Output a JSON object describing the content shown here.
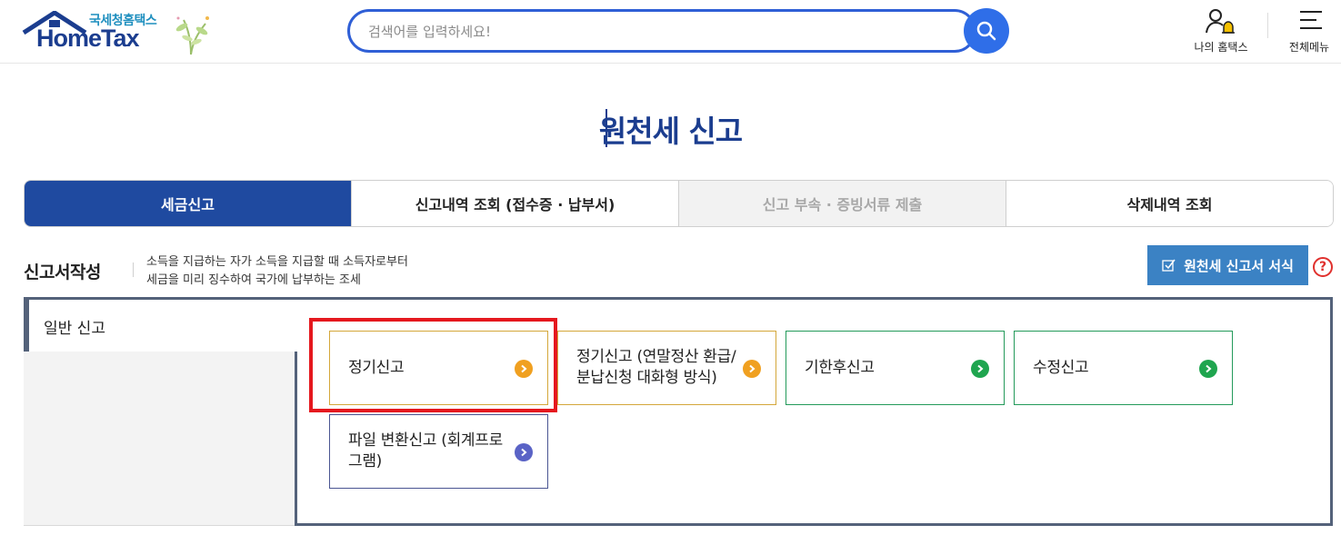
{
  "header": {
    "logo_small": "국세청홈택스",
    "logo_main": "HomeTax",
    "search_placeholder": "검색어를 입력하세요!",
    "my_hometax_label": "나의 홈택스",
    "all_menu_label": "전체메뉴"
  },
  "page": {
    "title": "원천세 신고"
  },
  "tabs": [
    {
      "label": "세금신고",
      "state": "active"
    },
    {
      "label": "신고내역 조회 (접수증 · 납부서)",
      "state": "normal"
    },
    {
      "label": "신고 부속 · 증빙서류 제출",
      "state": "disabled"
    },
    {
      "label": "삭제내역 조회",
      "state": "normal"
    }
  ],
  "section": {
    "title": "신고서작성",
    "desc_line1": "소득을 지급하는 자가 소득을 지급할 때 소득자로부터",
    "desc_line2": "세금을 미리 징수하여 국가에 납부하는 조세",
    "form_button_label": "원천세 신고서 서식",
    "help_symbol": "?"
  },
  "panel": {
    "left_tab_label": "일반 신고",
    "cards": [
      {
        "label": "정기신고",
        "color": "orange"
      },
      {
        "label": "정기신고 (연말정산 환급/분납신청 대화형 방식)",
        "color": "orange"
      },
      {
        "label": "기한후신고",
        "color": "green"
      },
      {
        "label": "수정신고",
        "color": "green"
      },
      {
        "label": "파일 변환신고 (회계프로그램)",
        "color": "purple"
      }
    ]
  },
  "colors": {
    "brand_navy": "#1b3d8f",
    "tab_active": "#1f4aa0",
    "form_button": "#3b82c4",
    "highlight_red": "#e5181e",
    "arrow_orange": "#f0a020",
    "arrow_green": "#1fa54f",
    "arrow_purple": "#5a63c6"
  },
  "icons": [
    "home-roof-icon",
    "plant-icon",
    "search-icon",
    "user-bell-icon",
    "hamburger-menu-icon",
    "checkbox-icon",
    "help-icon",
    "chevron-right-icon"
  ]
}
